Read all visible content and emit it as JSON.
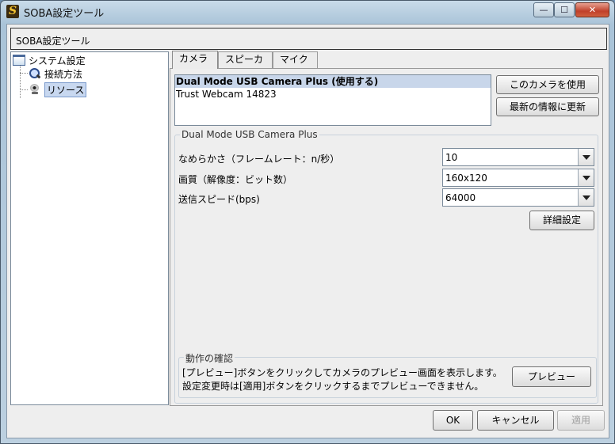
{
  "window": {
    "title": "SOBA設定ツール",
    "minimize": "—",
    "maximize": "☐",
    "close": "✕"
  },
  "header": {
    "label": "SOBA設定ツール"
  },
  "tree": {
    "root": "システム設定",
    "items": [
      {
        "label": "接続方法",
        "icon": "magnifier-icon"
      },
      {
        "label": "リソース",
        "icon": "webcam-icon",
        "selected": true
      }
    ]
  },
  "tabs": [
    {
      "label": "カメラ",
      "active": true
    },
    {
      "label": "スピーカ",
      "active": false
    },
    {
      "label": "マイク",
      "active": false
    }
  ],
  "camera": {
    "list": [
      {
        "label": "Dual Mode USB Camera Plus (使用する)",
        "selected": true
      },
      {
        "label": "Trust Webcam 14823",
        "selected": false
      }
    ],
    "use_button": "このカメラを使用",
    "refresh_button": "最新の情報に更新",
    "group_title": "Dual Mode USB Camera Plus",
    "fields": [
      {
        "label": "なめらかさ（フレームレート：n/秒）",
        "value": "10"
      },
      {
        "label": "画質（解像度：ビット数）",
        "value": "160x120"
      },
      {
        "label": "送信スピード(bps)",
        "value": "64000"
      }
    ],
    "advanced_button": "詳細設定",
    "check_group_title": "動作の確認",
    "check_text_1": "[プレビュー]ボタンをクリックしてカメラのプレビュー画面を表示します。",
    "check_text_2": "設定変更時は[適用]ボタンをクリックするまでプレビューできません。",
    "preview_button": "プレビュー"
  },
  "footer": {
    "ok": "OK",
    "cancel": "キャンセル",
    "apply": "適用"
  },
  "colors": {
    "selection": "#c8d6ea",
    "window_frame": "#a9c3d8",
    "close_button": "#c0402a"
  }
}
